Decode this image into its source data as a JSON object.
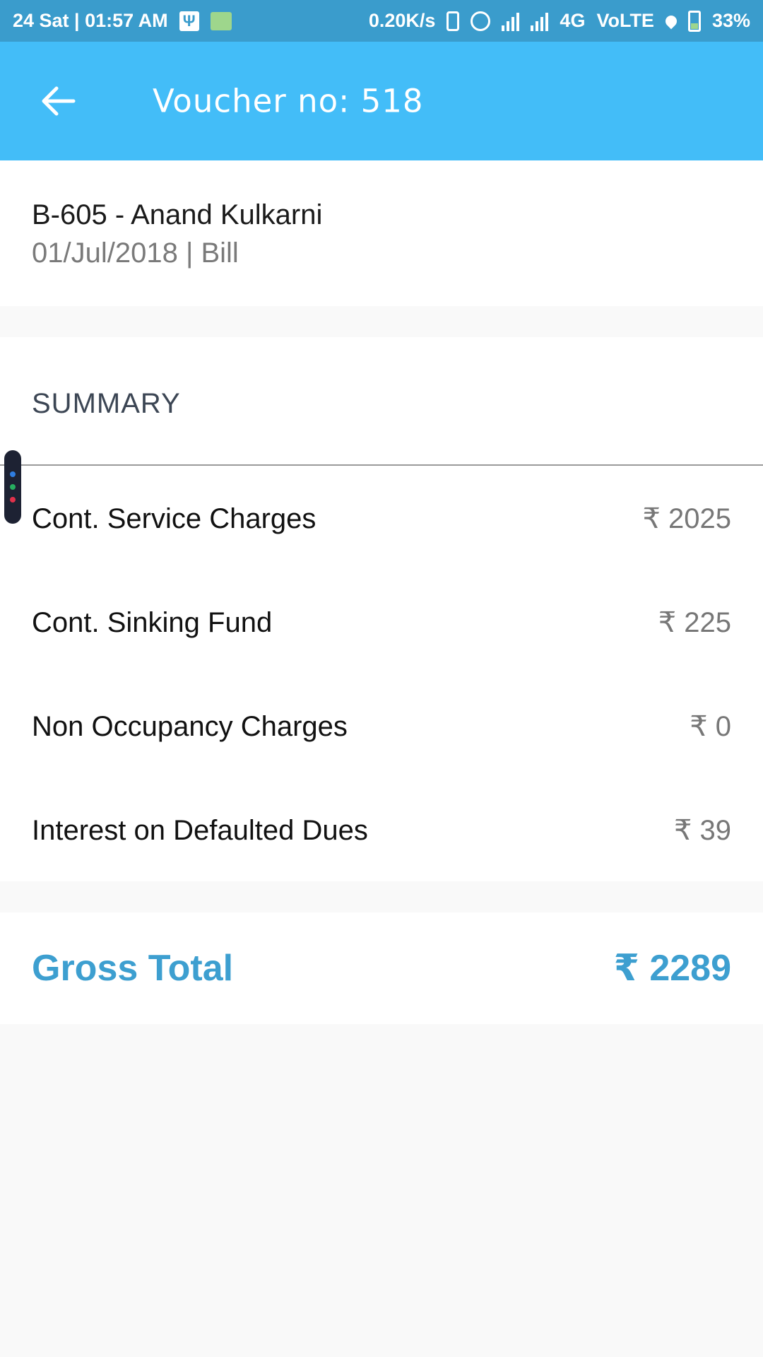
{
  "status_bar": {
    "left_text": "24 Sat | 01:57 AM",
    "speed": "0.20K/s",
    "network": "4G",
    "volte": "VoLTE",
    "battery": "33%"
  },
  "app_bar": {
    "title": "Voucher no: 518",
    "back_icon": "arrow-left-icon"
  },
  "header": {
    "member": "B-605 - Anand Kulkarni",
    "meta": "01/Jul/2018 | Bill"
  },
  "summary": {
    "heading": "SUMMARY",
    "rows": [
      {
        "label": "Cont. Service Charges",
        "value": "₹ 2025"
      },
      {
        "label": "Cont. Sinking Fund",
        "value": "₹ 225"
      },
      {
        "label": "Non Occupancy Charges",
        "value": "₹ 0"
      },
      {
        "label": "Interest on Defaulted Dues",
        "value": "₹ 39"
      }
    ]
  },
  "total": {
    "label": "Gross Total",
    "value": "₹ 2289"
  },
  "colors": {
    "status_bar": "#3a9ccc",
    "app_bar": "#43bdf8",
    "accent": "#3d9fd0",
    "page_background": "#f9f9f9"
  }
}
